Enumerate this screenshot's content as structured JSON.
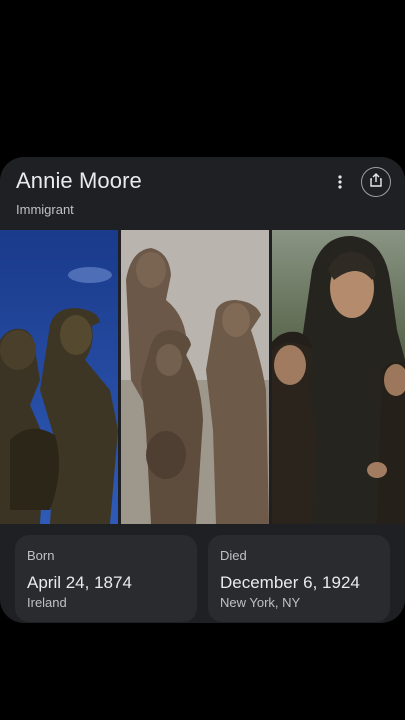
{
  "entity": {
    "name": "Annie Moore",
    "type": "Immigrant"
  },
  "icons": {
    "more": "more-vert-icon",
    "share": "share-icon"
  },
  "facts": [
    {
      "label": "Born",
      "value": "April 24, 1874",
      "detail": "Ireland"
    },
    {
      "label": "Died",
      "value": "December 6, 1924",
      "detail": "New York, NY"
    }
  ]
}
